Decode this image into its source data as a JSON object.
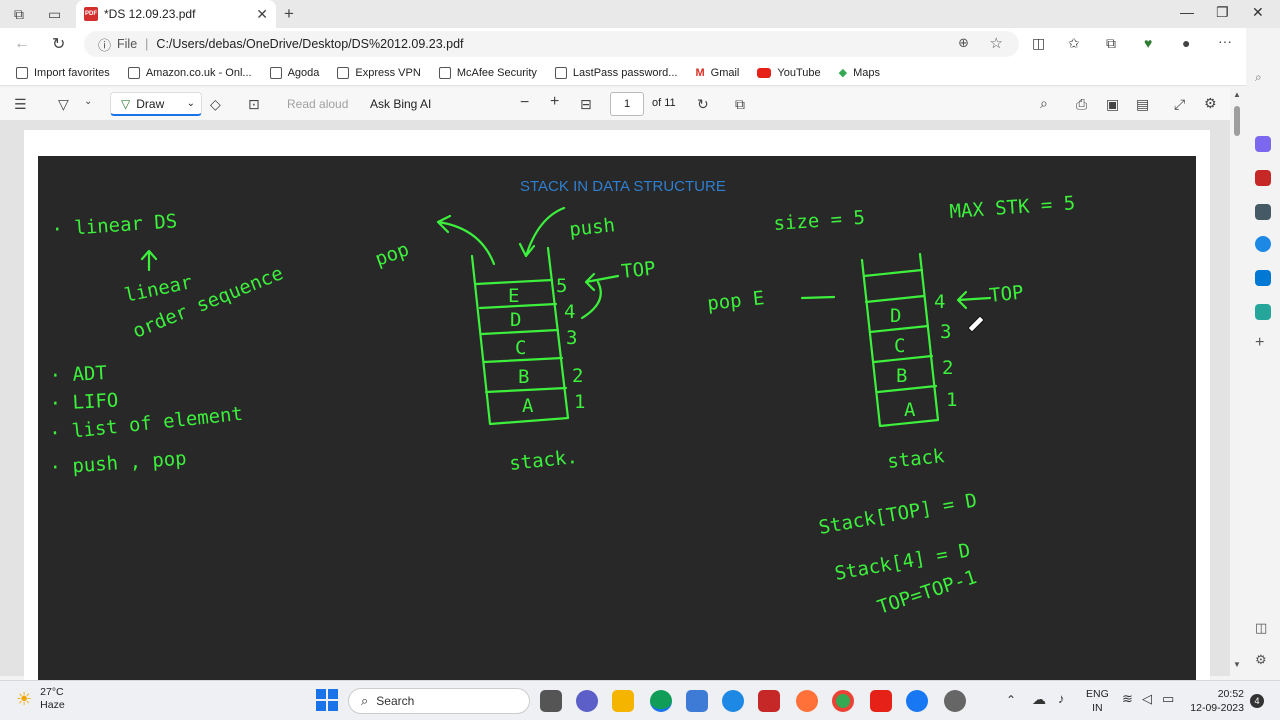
{
  "browser": {
    "tab_title": "*DS 12.09.23.pdf",
    "url_scheme": "File",
    "url_path": "C:/Users/debas/OneDrive/Desktop/DS%2012.09.23.pdf"
  },
  "bookmarks": [
    {
      "label": "Import favorites"
    },
    {
      "label": "Amazon.co.uk - Onl..."
    },
    {
      "label": "Agoda"
    },
    {
      "label": "Express VPN"
    },
    {
      "label": "McAfee Security"
    },
    {
      "label": "LastPass password..."
    },
    {
      "label": "Gmail"
    },
    {
      "label": "YouTube"
    },
    {
      "label": "Maps"
    }
  ],
  "pdf_toolbar": {
    "draw_label": "Draw",
    "read_aloud": "Read aloud",
    "ask_bing": "Ask Bing AI",
    "page_current": "1",
    "page_total": "of 11"
  },
  "slide": {
    "title": "STACK IN DATA STRUCTURE",
    "notes_left": [
      "· linear DS",
      "linear",
      "order sequence",
      "· ADT",
      "· LIFO",
      "· list of element",
      "· push , pop"
    ],
    "stack1": {
      "labels": [
        "pop",
        "push",
        "TOP",
        "stack."
      ],
      "cells": [
        "E",
        "D",
        "C",
        "B",
        "A"
      ],
      "indices": [
        "5",
        "4",
        "3",
        "2",
        "1"
      ]
    },
    "stack2": {
      "labels": [
        "size = 5",
        "MAX STK = 5",
        "pop E",
        "TOP",
        "stack"
      ],
      "cells": [
        "",
        "D",
        "C",
        "B",
        "A"
      ],
      "indices": [
        "4",
        "3",
        "2",
        "1"
      ],
      "equations": [
        "Stack[TOP] = D",
        "Stack[4] = D",
        "TOP=TOP-1"
      ]
    }
  },
  "taskbar": {
    "temperature": "27°C",
    "weather": "Haze",
    "search_placeholder": "Search",
    "lang_top": "ENG",
    "lang_bottom": "IN",
    "time": "20:52",
    "date": "12-09-2023",
    "notifications": "4"
  },
  "colors": {
    "ink": "#3cf03c",
    "slide_bg": "#282828",
    "title": "#2f7fd0"
  }
}
